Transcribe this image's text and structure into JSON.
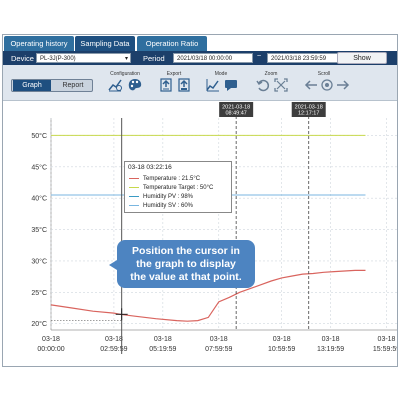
{
  "tabs": [
    {
      "label": "Operating history",
      "active": false
    },
    {
      "label": "Sampling Data",
      "active": true
    },
    {
      "label": "Operation Ratio",
      "active": false
    }
  ],
  "device_bar": {
    "device_label": "Device",
    "device_value": "PL-3J(P-300)",
    "period_label": "Period",
    "period_start": "2021/03/18 00:00:00",
    "period_separator": "~",
    "period_end": "2021/03/18 23:59:59",
    "show_label": "Show"
  },
  "toolbar": {
    "view_toggle": {
      "graph": "Graph",
      "report": "Report",
      "selected": "Graph"
    },
    "groups": {
      "configuration": "Configuration",
      "export": "Export",
      "mode": "Mode",
      "zoom": "Zoom",
      "scroll": "Scroll"
    },
    "icons": [
      "chart-settings-icon",
      "palette-icon",
      "export-csv-icon",
      "export-image-icon",
      "graph-mode-icon",
      "comment-mode-icon",
      "zoom-reset-icon",
      "zoom-fit-icon",
      "scroll-left-icon",
      "scroll-center-icon",
      "scroll-right-icon"
    ]
  },
  "tooltip": {
    "time": "03-18 03:22:16",
    "rows": [
      {
        "text": "Temperature : 21.5°C",
        "color": "#d9645e"
      },
      {
        "text": "Temperature Target : 50°C",
        "color": "#c7d94c"
      },
      {
        "text": "Humidity PV : 98%",
        "color": "#3a9bc4"
      },
      {
        "text": "Humidity SV : 60%",
        "color": "#79b6e0"
      }
    ]
  },
  "callout": {
    "lines": [
      "Position the cursor in",
      "the graph to display",
      "the value at that point."
    ]
  },
  "markers": [
    {
      "date": "2021-03-18",
      "time": "08:49:47"
    },
    {
      "date": "2021-03-18",
      "time": "12:17:17"
    }
  ],
  "chart_data": {
    "type": "line",
    "x_hours": [
      0,
      1,
      2,
      3,
      3.3,
      4,
      5,
      6,
      6.5,
      7,
      7.5,
      8,
      8.5,
      9,
      9.5,
      10,
      10.5,
      11,
      11.5,
      12,
      12.5,
      13,
      13.5,
      14,
      14.5,
      15
    ],
    "series": [
      {
        "name": "Temperature",
        "color": "#d9645e",
        "values": [
          23.0,
          22.5,
          22.0,
          21.7,
          21.5,
          21.2,
          20.8,
          20.5,
          20.4,
          20.5,
          21.0,
          23.5,
          24.2,
          25.0,
          25.6,
          26.2,
          26.8,
          27.3,
          27.6,
          27.9,
          28.0,
          28.2,
          28.3,
          28.4,
          28.5,
          28.5
        ]
      },
      {
        "name": "Temperature Target",
        "color": "#c7d94c",
        "values": [
          50,
          50,
          50,
          50,
          50,
          50,
          50,
          50,
          50,
          50,
          50,
          50,
          50,
          50,
          50,
          50,
          50,
          50,
          50,
          50,
          50,
          50,
          50,
          50,
          50,
          50
        ]
      },
      {
        "name": "Humidity SV",
        "color": "#79b6e0",
        "values": [
          40.5,
          40.5,
          40.5,
          40.5,
          40.5,
          40.5,
          40.5,
          40.5,
          40.5,
          40.5,
          40.5,
          40.5,
          40.5,
          40.5,
          40.5,
          40.5,
          40.5,
          40.5,
          40.5,
          40.5,
          40.5,
          40.5,
          40.5,
          40.5,
          40.5,
          40.5
        ]
      }
    ],
    "y_ticks": [
      "20°C",
      "25°C",
      "30°C",
      "35°C",
      "40°C",
      "45°C",
      "50°C"
    ],
    "y_values": [
      20,
      25,
      30,
      35,
      40,
      45,
      50
    ],
    "ylim": [
      19,
      51.5
    ],
    "x_ticks": [
      {
        "date": "03-18",
        "time": "00:00:00",
        "hour": 0
      },
      {
        "date": "03-18",
        "time": "02:59:59",
        "hour": 3
      },
      {
        "date": "03-18",
        "time": "05:19:59",
        "hour": 5.333
      },
      {
        "date": "03-18",
        "time": "07:59:59",
        "hour": 8
      },
      {
        "date": "03-18",
        "time": "10:59:59",
        "hour": 11
      },
      {
        "date": "03-18",
        "time": "13:19:59",
        "hour": 13.333
      },
      {
        "date": "03-18",
        "time": "15:59:59",
        "hour": 16
      }
    ],
    "xlim": [
      0,
      16.5
    ],
    "cursor_hour": 3.37,
    "cursor_value": 21.5,
    "marker_hours": [
      8.83,
      12.29
    ],
    "grid": true
  }
}
